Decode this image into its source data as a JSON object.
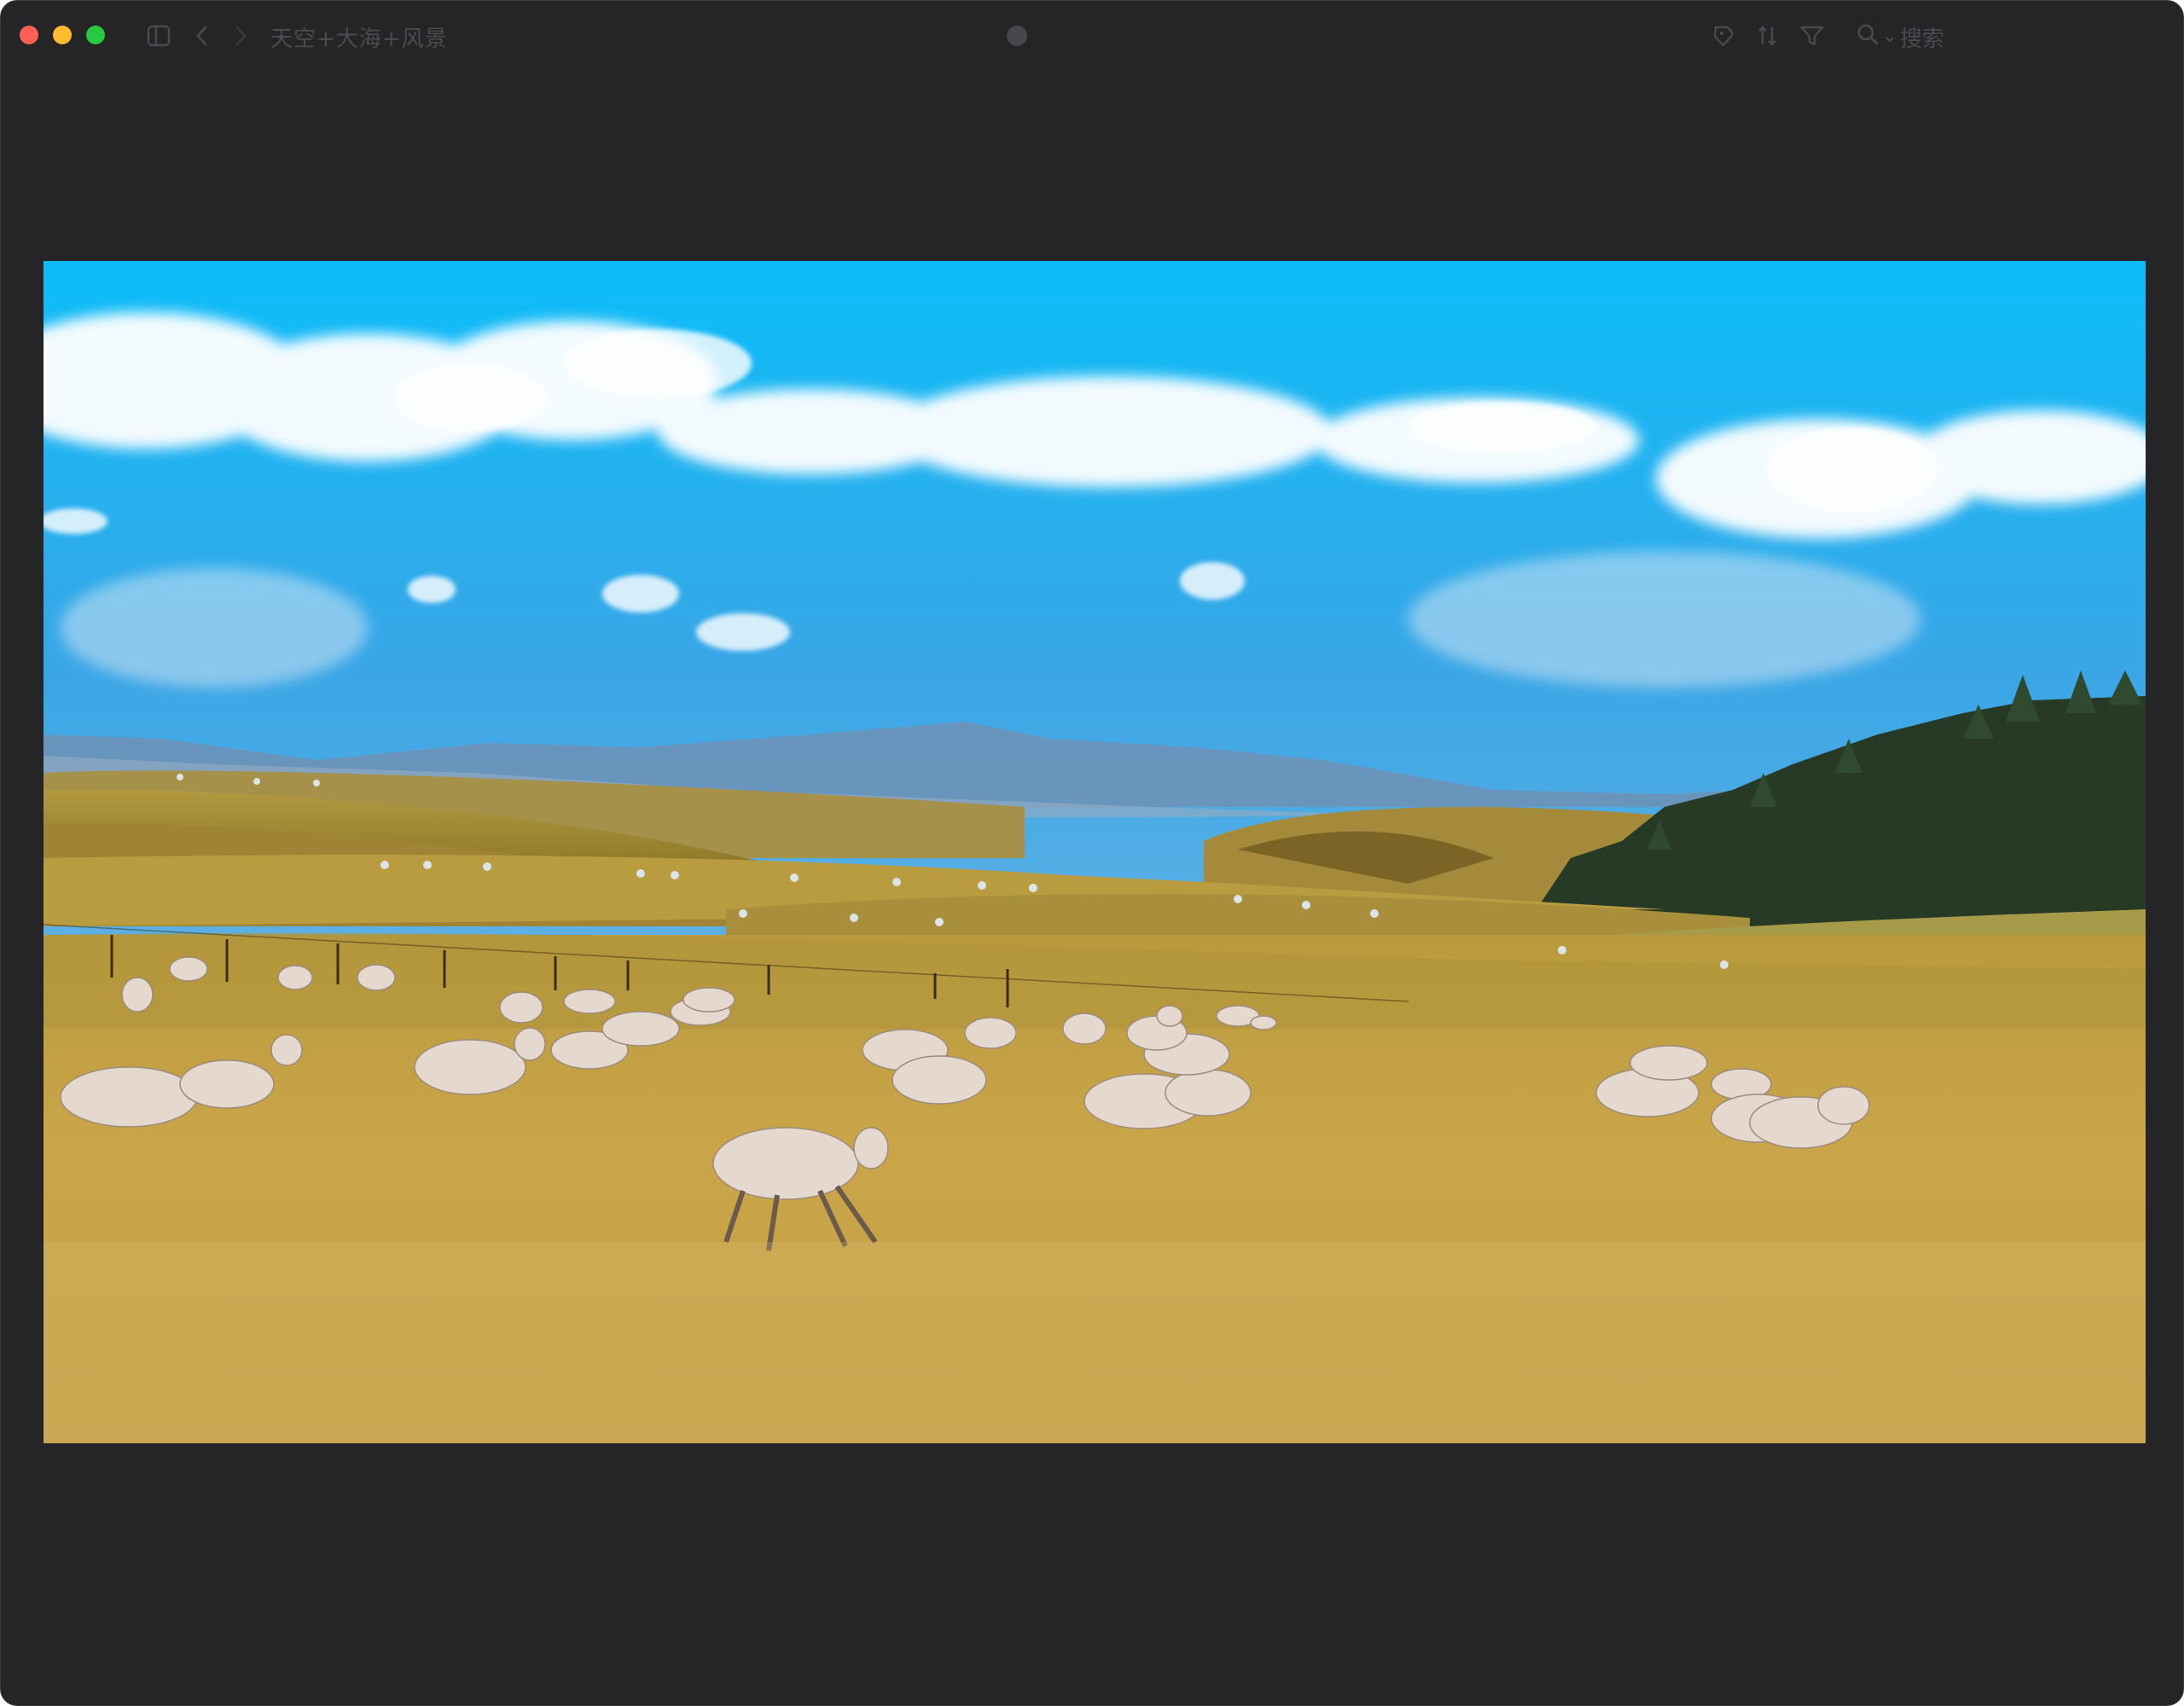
{
  "window": {
    "title": "天空+大海+风景"
  },
  "toolbar": {
    "search_placeholder": "搜索",
    "icons": [
      "sidebar-toggle-icon",
      "back-chevron-icon",
      "forward-chevron-icon",
      "tag-icon",
      "sort-icon",
      "filter-icon",
      "search-icon"
    ]
  },
  "colors": {
    "window_bg": "#252527",
    "close": "#fe5f57",
    "minimize": "#febc2e",
    "zoom": "#28c840",
    "sky_top": "#00bfff",
    "grass": "#c9a548"
  }
}
